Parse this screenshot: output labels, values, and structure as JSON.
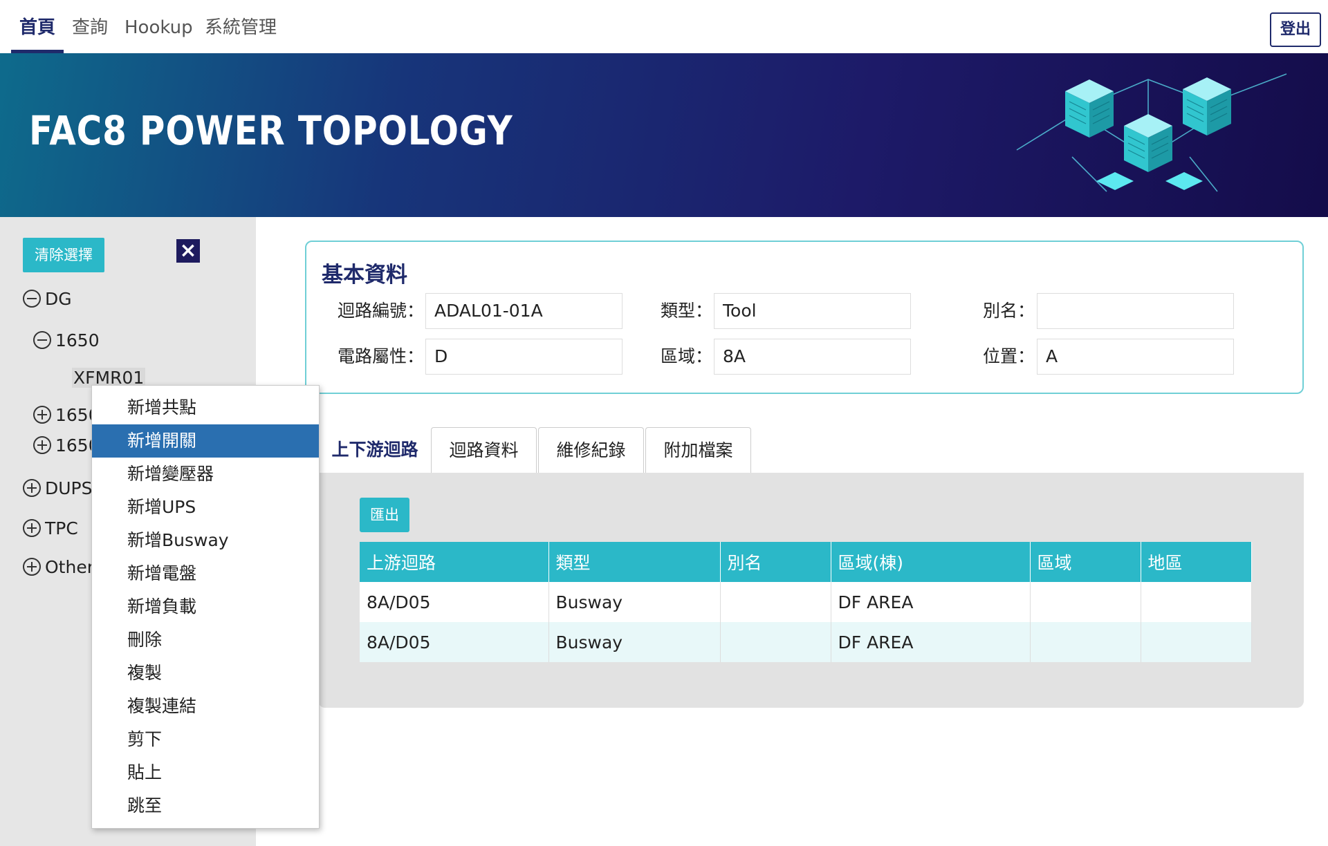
{
  "nav": {
    "items": [
      {
        "label": "首頁",
        "active": true
      },
      {
        "label": "查詢",
        "active": false
      },
      {
        "label": "Hookup",
        "active": false
      },
      {
        "label": "系統管理",
        "active": false
      }
    ],
    "logout_label": "登出"
  },
  "banner": {
    "title": "FAC8 POWER TOPOLOGY"
  },
  "sidebar": {
    "clear_label": "清除選擇",
    "close_icon": "×",
    "tree": [
      {
        "label": "DG",
        "state": "expanded"
      },
      {
        "label": "1650",
        "state": "expanded"
      },
      {
        "label": "XFMR01",
        "state": "leaf-selected"
      },
      {
        "label": "1650",
        "state": "collapsed"
      },
      {
        "label": "1650",
        "state": "collapsed"
      },
      {
        "label": "DUPS",
        "state": "collapsed"
      },
      {
        "label": "TPC",
        "state": "collapsed"
      },
      {
        "label": "Other",
        "state": "collapsed"
      }
    ]
  },
  "context_menu": {
    "items": [
      "新增共點",
      "新增開關",
      "新增變壓器",
      "新增UPS",
      "新增Busway",
      "新增電盤",
      "新增負載",
      "刪除",
      "複製",
      "複製連結",
      "剪下",
      "貼上",
      "跳至"
    ],
    "active_index": 1
  },
  "info": {
    "title": "基本資料",
    "fields": [
      {
        "label": "迴路編號：",
        "value": "ADAL01-01A"
      },
      {
        "label": "類型：",
        "value": "Tool"
      },
      {
        "label": "別名：",
        "value": ""
      },
      {
        "label": "電路屬性：",
        "value": "D"
      },
      {
        "label": "區域：",
        "value": "8A"
      },
      {
        "label": "位置：",
        "value": "A"
      }
    ]
  },
  "tabs": [
    {
      "label": "上下游迴路",
      "active": true
    },
    {
      "label": "迴路資料",
      "active": false
    },
    {
      "label": "維修紀錄",
      "active": false
    },
    {
      "label": "附加檔案",
      "active": false
    }
  ],
  "panel": {
    "export_label": "匯出",
    "columns": [
      "上游迴路",
      "類型",
      "別名",
      "區域(棟)",
      "區域",
      "地區"
    ],
    "rows": [
      [
        "8A/D05",
        "Busway",
        "",
        "DF AREA",
        "",
        ""
      ],
      [
        "8A/D05",
        "Busway",
        "",
        "DF AREA",
        "",
        ""
      ]
    ]
  },
  "colors": {
    "brand": "#1f2a6b",
    "accent": "#2bb8c8",
    "menu_highlight": "#2a6fb0"
  }
}
